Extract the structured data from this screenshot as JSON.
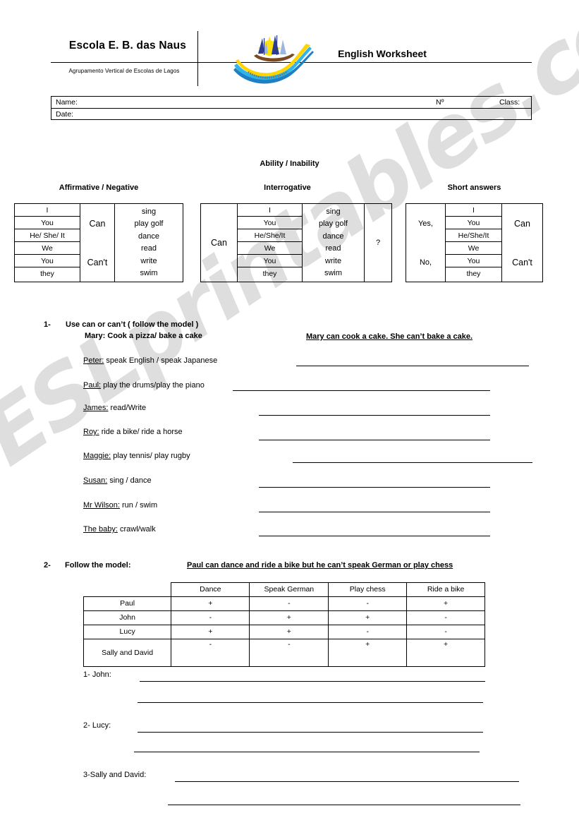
{
  "header": {
    "school_name": "Escola E. B. das Naus",
    "school_subtitle": "Agrupamento Vertical de Escolas de Lagos",
    "worksheet_title": "English Worksheet",
    "logo_name": "school-sailboat-logo",
    "logo_colors": {
      "sun": "#ffe20a",
      "sail_dark": "#2c3d8f",
      "sail_light": "#9bb7e0",
      "hull": "#7a4a22",
      "wave_yellow": "#ffd400",
      "wave_cyan": "#2fb5e8",
      "wave_blue": "#1f7fc4"
    }
  },
  "student_fields": {
    "name_label": "Name:",
    "number_label": "Nº",
    "class_label": "Class:",
    "date_label": "Date:"
  },
  "section_title": "Ability / Inability",
  "grammar": {
    "affirmative": {
      "title": "Affirmative / Negative",
      "pronouns": [
        "I",
        "You",
        "He/ She/ It",
        "We",
        "You",
        "they"
      ],
      "modals": [
        "Can",
        "Can't"
      ],
      "verbs": [
        "sing",
        "play golf",
        "dance",
        "read",
        "write",
        "swim"
      ]
    },
    "interrogative": {
      "title": "Interrogative",
      "modal": "Can",
      "pronouns": [
        "I",
        "You",
        "He/She/It",
        "We",
        "You",
        "they"
      ],
      "verbs": [
        "sing",
        "play golf",
        "dance",
        "read",
        "write",
        "swim"
      ],
      "question_mark": "?"
    },
    "short_answers": {
      "title": "Short answers",
      "yes": "Yes,",
      "no": "No,",
      "pronouns": [
        "I",
        "You",
        "He/She/It",
        "We",
        "You",
        "they"
      ],
      "modals": [
        "Can",
        "Can't"
      ]
    }
  },
  "exercise1": {
    "number": "1-",
    "instruction": "Use can or can’t ( follow the model )",
    "model_prompt": "Mary: Cook a pizza/ bake a cake",
    "model_answer": "Mary can cook a cake. She can’t bake a cake.",
    "items": [
      {
        "name": "Peter:",
        "task": "speak English / speak Japanese"
      },
      {
        "name": "Paul:",
        "task": "play the drums/play the piano"
      },
      {
        "name": "James:",
        "task": "read/Write"
      },
      {
        "name": "Roy:",
        "task": "ride a bike/ ride a horse"
      },
      {
        "name": "Maggie:",
        "task": "play tennis/ play rugby"
      },
      {
        "name": "Susan:",
        "task": "sing / dance"
      },
      {
        "name": "Mr Wilson:",
        "task": "run / swim"
      },
      {
        "name": "The baby:",
        "task": "crawl/walk"
      }
    ]
  },
  "exercise2": {
    "number": "2-",
    "instruction": "Follow the model:",
    "model_answer": "Paul can dance and ride a bike but he can’t speak German or play chess",
    "table": {
      "corner": "",
      "columns": [
        "Dance",
        "Speak German",
        "Play chess",
        "Ride a bike"
      ],
      "rows": [
        {
          "label": "Paul",
          "values": [
            "+",
            "-",
            "-",
            "+"
          ]
        },
        {
          "label": "John",
          "values": [
            "-",
            "+",
            "+",
            "-"
          ]
        },
        {
          "label": "Lucy",
          "values": [
            "+",
            "+",
            "-",
            "-"
          ]
        },
        {
          "label": "Sally and David",
          "values": [
            "-",
            "-",
            "+",
            "+"
          ]
        }
      ]
    },
    "answers": [
      {
        "label": "1-  John:"
      },
      {
        "label": "2- Lucy:"
      },
      {
        "label": "3-Sally and David:"
      }
    ]
  },
  "watermark": {
    "text": "ESLprintables.com"
  }
}
